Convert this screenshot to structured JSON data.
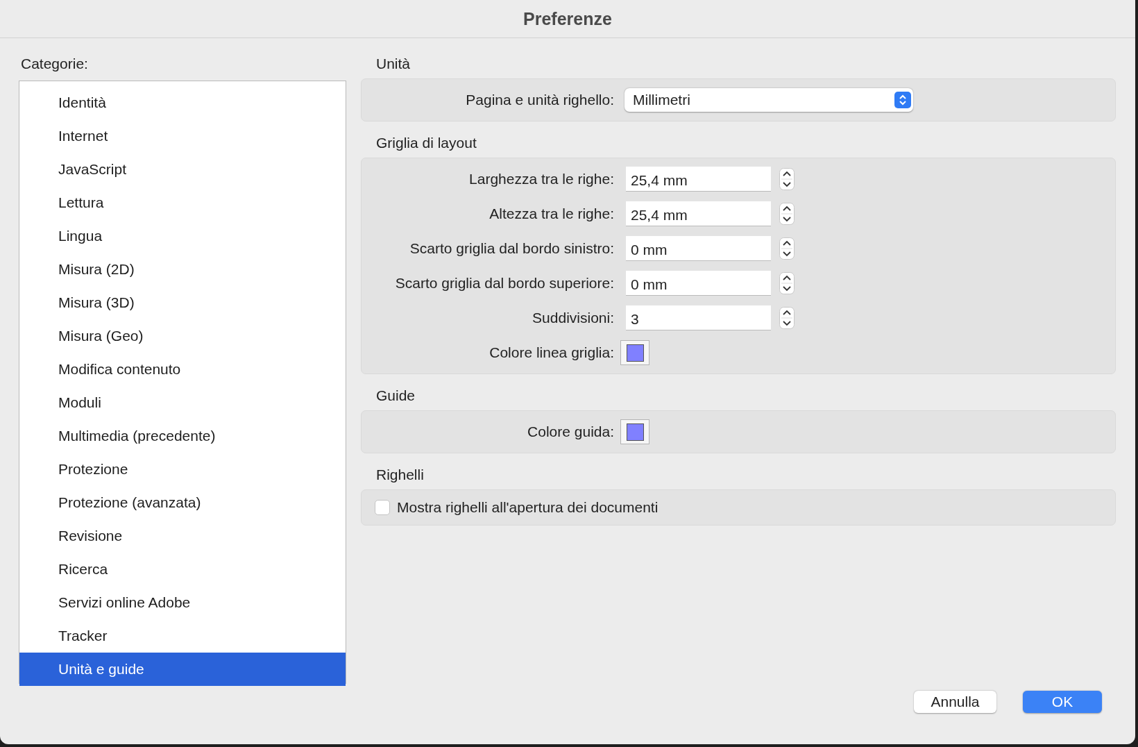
{
  "window": {
    "title": "Preferenze"
  },
  "sidebar": {
    "label": "Categorie:",
    "items": [
      {
        "label": "Identità",
        "selected": false
      },
      {
        "label": "Internet",
        "selected": false
      },
      {
        "label": "JavaScript",
        "selected": false
      },
      {
        "label": "Lettura",
        "selected": false
      },
      {
        "label": "Lingua",
        "selected": false
      },
      {
        "label": "Misura (2D)",
        "selected": false
      },
      {
        "label": "Misura (3D)",
        "selected": false
      },
      {
        "label": "Misura (Geo)",
        "selected": false
      },
      {
        "label": "Modifica contenuto",
        "selected": false
      },
      {
        "label": "Moduli",
        "selected": false
      },
      {
        "label": "Multimedia (precedente)",
        "selected": false
      },
      {
        "label": "Protezione",
        "selected": false
      },
      {
        "label": "Protezione (avanzata)",
        "selected": false
      },
      {
        "label": "Revisione",
        "selected": false
      },
      {
        "label": "Ricerca",
        "selected": false
      },
      {
        "label": "Servizi online Adobe",
        "selected": false
      },
      {
        "label": "Tracker",
        "selected": false
      },
      {
        "label": "Unità e guide",
        "selected": true
      }
    ]
  },
  "sections": [
    {
      "title": "Unità",
      "rows": [
        {
          "kind": "select",
          "label": "Pagina e unità righello:",
          "value": "Millimetri"
        }
      ]
    },
    {
      "title": "Griglia di layout",
      "rows": [
        {
          "kind": "stepper",
          "label": "Larghezza tra le righe:",
          "value": "25,4 mm"
        },
        {
          "kind": "stepper",
          "label": "Altezza tra le righe:",
          "value": "25,4 mm"
        },
        {
          "kind": "stepper",
          "label": "Scarto griglia dal bordo sinistro:",
          "value": "0 mm"
        },
        {
          "kind": "stepper",
          "label": "Scarto griglia dal bordo superiore:",
          "value": "0 mm"
        },
        {
          "kind": "stepper",
          "label": "Suddivisioni:",
          "value": "3"
        },
        {
          "kind": "color",
          "label": "Colore linea griglia:",
          "color": "#8080ff"
        }
      ]
    },
    {
      "title": "Guide",
      "rows": [
        {
          "kind": "color",
          "label": "Colore guida:",
          "color": "#8080ff"
        }
      ]
    },
    {
      "title": "Righelli",
      "rows": [
        {
          "kind": "checkbox",
          "label": "Mostra righelli all'apertura dei documenti",
          "checked": false
        }
      ]
    }
  ],
  "buttons": [
    {
      "label": "Annulla",
      "kind": "secondary"
    },
    {
      "label": "OK",
      "kind": "primary"
    }
  ]
}
